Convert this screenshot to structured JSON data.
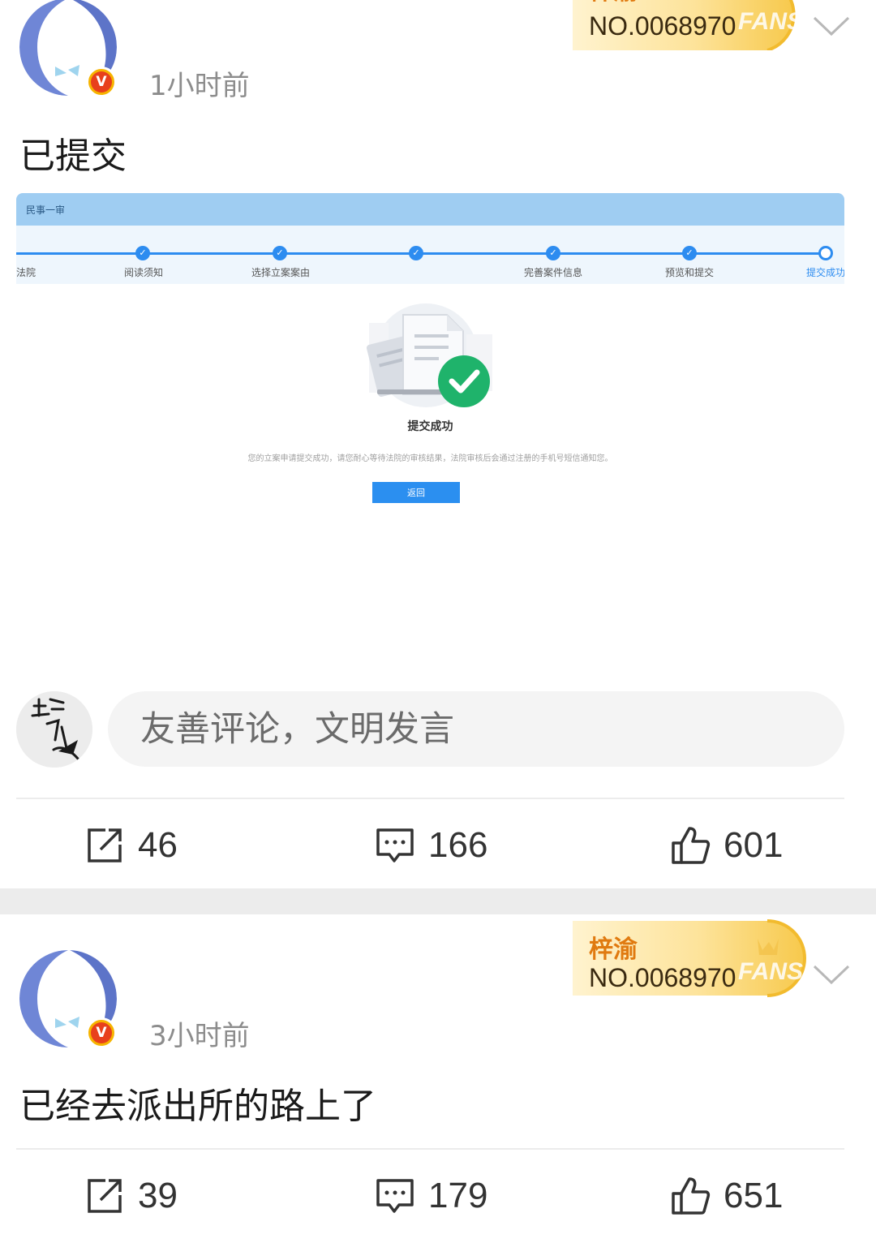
{
  "posts": [
    {
      "time": "1小时前",
      "fans_name": "梓渝",
      "fans_no": "NO.0068970",
      "fans_word": "FANS",
      "verified_mark": "V",
      "content": "已提交",
      "actions": {
        "repost": "46",
        "comment": "166",
        "like": "601"
      },
      "screenshot": {
        "tab": "民事一审",
        "steps": [
          "法院",
          "阅读须知",
          "选择立案案由",
          "",
          "完善案件信息",
          "预览和提交",
          "提交成功"
        ],
        "title": "提交成功",
        "desc": "您的立案申请提交成功，请您耐心等待法院的审核结果，法院审核后会通过注册的手机号短信通知您。",
        "button": "返回"
      }
    },
    {
      "time": "3小时前",
      "fans_name": "梓渝",
      "fans_no": "NO.0068970",
      "fans_word": "FANS",
      "verified_mark": "V",
      "content": "已经去派出所的路上了",
      "actions": {
        "repost": "39",
        "comment": "179",
        "like": "651"
      }
    }
  ],
  "comment_box": {
    "placeholder": "友善评论，文明发言"
  },
  "icons": {
    "repost": "share-icon",
    "comment": "comment-icon",
    "like": "thumbs-up-icon",
    "more": "chevron-down-icon"
  },
  "colors": {
    "accent": "#2b8ff0",
    "gold": "#f7d66a",
    "verified": "#e8401c"
  }
}
